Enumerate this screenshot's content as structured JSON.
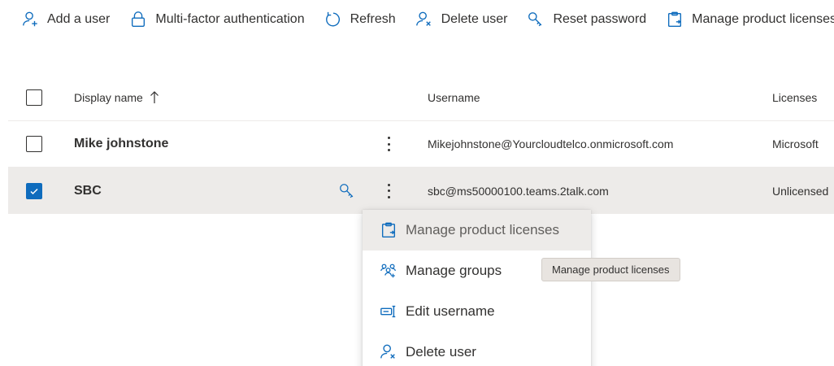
{
  "toolbar": {
    "add_user": "Add a user",
    "mfa": "Multi-factor authentication",
    "refresh": "Refresh",
    "delete_user": "Delete user",
    "reset_password": "Reset password",
    "manage_licenses": "Manage product licenses"
  },
  "table": {
    "columns": {
      "display_name": "Display name",
      "username": "Username",
      "licenses": "Licenses"
    },
    "rows": [
      {
        "display_name": "Mike johnstone",
        "username": "Mikejohnstone@Yourcloudtelco.onmicrosoft.com",
        "licenses": "Microsoft",
        "selected": false
      },
      {
        "display_name": "SBC",
        "username": "sbc@ms50000100.teams.2talk.com",
        "licenses": "Unlicensed",
        "selected": true
      }
    ]
  },
  "context_menu": {
    "items": [
      {
        "label": "Manage product licenses",
        "icon": "clipboard-icon"
      },
      {
        "label": "Manage groups",
        "icon": "groups-icon"
      },
      {
        "label": "Edit username",
        "icon": "edit-username-icon"
      },
      {
        "label": "Delete user",
        "icon": "delete-user-icon"
      }
    ]
  },
  "tooltip": {
    "text": "Manage product licenses"
  },
  "colors": {
    "accent": "#0f6cbd",
    "selected_row": "#edebe9",
    "text": "#323130"
  }
}
